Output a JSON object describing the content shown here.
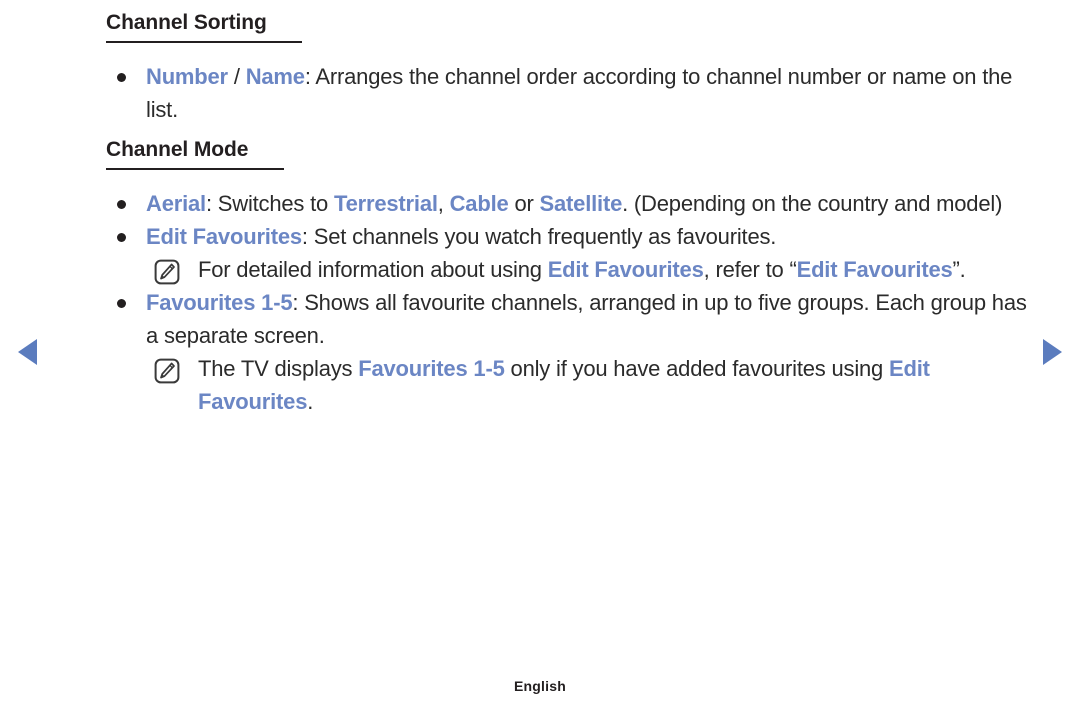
{
  "document": {
    "sections": [
      {
        "heading": "Channel Sorting",
        "heading_rule_width": 196,
        "items": [
          {
            "type": "bullet",
            "parts": [
              {
                "text": "Number",
                "style": "keyword"
              },
              {
                "text": " / ",
                "style": "plain"
              },
              {
                "text": "Name",
                "style": "keyword"
              },
              {
                "text": ": Arranges the channel order according to channel number or name on the list.",
                "style": "plain"
              }
            ]
          }
        ]
      },
      {
        "heading": "Channel Mode",
        "heading_rule_width": 178,
        "items": [
          {
            "type": "bullet",
            "parts": [
              {
                "text": "Aerial",
                "style": "keyword"
              },
              {
                "text": ": Switches to ",
                "style": "plain"
              },
              {
                "text": "Terrestrial",
                "style": "keyword"
              },
              {
                "text": ", ",
                "style": "plain"
              },
              {
                "text": "Cable",
                "style": "keyword"
              },
              {
                "text": " or ",
                "style": "plain"
              },
              {
                "text": "Satellite",
                "style": "keyword"
              },
              {
                "text": ". (Depending on the country and model)",
                "style": "plain"
              }
            ]
          },
          {
            "type": "bullet",
            "parts": [
              {
                "text": "Edit Favourites",
                "style": "keyword"
              },
              {
                "text": ": Set channels you watch frequently as favourites.",
                "style": "plain"
              }
            ]
          },
          {
            "type": "note",
            "icon": "note-pencil-icon",
            "parts": [
              {
                "text": "For detailed information about using ",
                "style": "plain"
              },
              {
                "text": "Edit Favourites",
                "style": "keyword"
              },
              {
                "text": ", refer to “",
                "style": "plain"
              },
              {
                "text": "Edit Favourites",
                "style": "keyword"
              },
              {
                "text": "”.",
                "style": "plain"
              }
            ]
          },
          {
            "type": "bullet",
            "parts": [
              {
                "text": "Favourites 1-5",
                "style": "keyword"
              },
              {
                "text": ": Shows all favourite channels, arranged in up to five groups. Each group has a separate screen.",
                "style": "plain"
              }
            ]
          },
          {
            "type": "note",
            "icon": "note-pencil-icon",
            "parts": [
              {
                "text": "The TV displays ",
                "style": "plain"
              },
              {
                "text": "Favourites 1-5",
                "style": "keyword"
              },
              {
                "text": " only if you have added favourites using ",
                "style": "plain"
              },
              {
                "text": "Edit Favourites",
                "style": "keyword"
              },
              {
                "text": ".",
                "style": "plain"
              }
            ]
          }
        ]
      }
    ]
  },
  "navigation": {
    "prev_label": "previous-page",
    "next_label": "next-page",
    "arrow_color": "#5b7cbe"
  },
  "footer": {
    "language": "English"
  },
  "colors": {
    "keyword": "#6b86c4",
    "text": "#2b2b2b",
    "heading": "#231f20",
    "background": "#ffffff"
  }
}
